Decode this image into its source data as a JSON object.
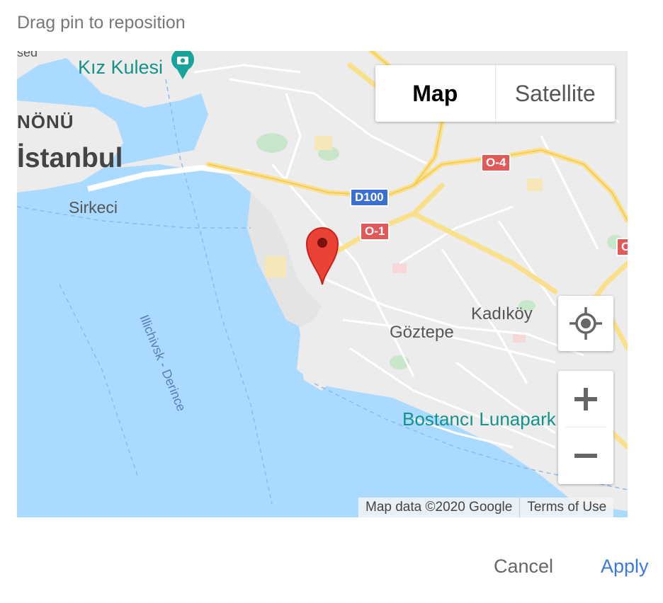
{
  "hint_text": "Drag pin to reposition",
  "map": {
    "map_type_options": {
      "map": "Map",
      "satellite": "Satellite",
      "selected": "Map"
    },
    "places": {
      "kiz_kulesi": "Kız Kulesi",
      "eminonu": "NÖNÜ",
      "istanbul": "İstanbul",
      "sirkeci": "Sirkeci",
      "ilichivsk": "Illichivsk - Derince",
      "kadikoy": "Kadıköy",
      "goztepe": "Göztepe",
      "bostanci": "Bostancı Lunapark",
      "sed": "sed"
    },
    "road_shields": {
      "d100": "D100",
      "o1": "O-1",
      "o4": "O-4",
      "edge": "O"
    },
    "attribution": {
      "map_data": "Map data ©2020 Google",
      "terms": "Terms of Use"
    },
    "colors": {
      "water": "#aadaff",
      "land": "#ececec",
      "highway": "#fbe08c",
      "pin": "#ea4335",
      "park": "#c8e6c9"
    }
  },
  "controls": {
    "zoom_in_icon": "plus-icon",
    "zoom_out_icon": "minus-icon",
    "locate_icon": "crosshair-icon"
  },
  "footer": {
    "cancel_label": "Cancel",
    "apply_label": "Apply"
  }
}
